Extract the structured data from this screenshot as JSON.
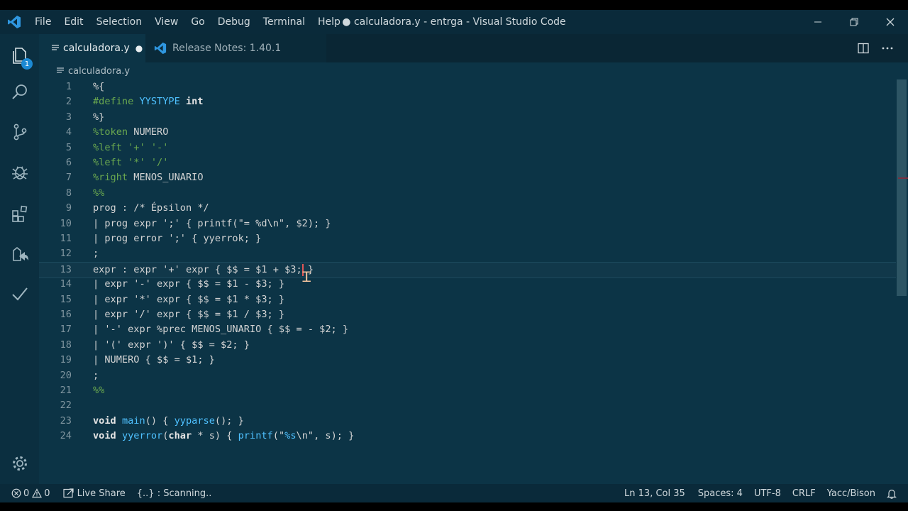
{
  "titlebar": {
    "menu": [
      "File",
      "Edit",
      "Selection",
      "View",
      "Go",
      "Debug",
      "Terminal",
      "Help"
    ],
    "window_title": "● calculadora.y - entrga - Visual Studio Code",
    "controls": {
      "minimize": "—",
      "restore": "❐",
      "close": "✕"
    }
  },
  "activity": {
    "items": [
      "explorer-icon",
      "search-icon",
      "source-control-icon",
      "debug-icon",
      "extensions-icon",
      "live-share-icon",
      "checkmark-icon"
    ],
    "explorer_badge": "1",
    "manage": "gear-icon"
  },
  "tabs": [
    {
      "label": "calculadora.y",
      "active": true,
      "dirty_indicator": "●"
    },
    {
      "label": "Release Notes: 1.40.1",
      "active": false
    }
  ],
  "breadcrumb": {
    "file": "calculadora.y"
  },
  "editor": {
    "current_line": 13,
    "lines": [
      {
        "n": "1",
        "segments": [
          {
            "t": "%{",
            "c": "p"
          }
        ]
      },
      {
        "n": "2",
        "segments": [
          {
            "t": "#define ",
            "c": "dir"
          },
          {
            "t": "YYSTYPE",
            "c": "mac"
          },
          {
            "t": " ",
            "c": "p"
          },
          {
            "t": "int",
            "c": "kw"
          }
        ]
      },
      {
        "n": "3",
        "segments": [
          {
            "t": "%}",
            "c": "p"
          }
        ]
      },
      {
        "n": "4",
        "segments": [
          {
            "t": "%token",
            "c": "dir"
          },
          {
            "t": " NUMERO",
            "c": "p"
          }
        ]
      },
      {
        "n": "5",
        "segments": [
          {
            "t": "%left '+' '-'",
            "c": "dir"
          }
        ]
      },
      {
        "n": "6",
        "segments": [
          {
            "t": "%left '*' '/'",
            "c": "dir"
          }
        ]
      },
      {
        "n": "7",
        "segments": [
          {
            "t": "%right",
            "c": "dir"
          },
          {
            "t": " MENOS_UNARIO",
            "c": "p"
          }
        ]
      },
      {
        "n": "8",
        "segments": [
          {
            "t": "%%",
            "c": "dir"
          }
        ]
      },
      {
        "n": "9",
        "segments": [
          {
            "t": "prog : /* Épsilon */",
            "c": "p"
          }
        ]
      },
      {
        "n": "10",
        "segments": [
          {
            "t": "| prog expr ';' { printf(\"= %d\\n\", $2); }",
            "c": "p"
          }
        ]
      },
      {
        "n": "11",
        "segments": [
          {
            "t": "| prog error ';' { yyerrok; }",
            "c": "p"
          }
        ]
      },
      {
        "n": "12",
        "segments": [
          {
            "t": ";",
            "c": "p"
          }
        ]
      },
      {
        "n": "13",
        "segments": [
          {
            "t": "expr : expr '+' expr { $$ = $1 + $3; }",
            "c": "p"
          }
        ]
      },
      {
        "n": "14",
        "segments": [
          {
            "t": "| expr '-' expr { $$ = $1 - $3; }",
            "c": "p"
          }
        ]
      },
      {
        "n": "15",
        "segments": [
          {
            "t": "| expr '*' expr { $$ = $1 * $3; }",
            "c": "p"
          }
        ]
      },
      {
        "n": "16",
        "segments": [
          {
            "t": "| expr '/' expr { $$ = $1 / $3; }",
            "c": "p"
          }
        ]
      },
      {
        "n": "17",
        "segments": [
          {
            "t": "| '-' expr %prec MENOS_UNARIO { $$ = - $2; }",
            "c": "p"
          }
        ]
      },
      {
        "n": "18",
        "segments": [
          {
            "t": "| '(' expr ')' { $$ = $2; }",
            "c": "p"
          }
        ]
      },
      {
        "n": "19",
        "segments": [
          {
            "t": "| NUMERO { $$ = $1; }",
            "c": "p"
          }
        ]
      },
      {
        "n": "20",
        "segments": [
          {
            "t": ";",
            "c": "p"
          }
        ]
      },
      {
        "n": "21",
        "segments": [
          {
            "t": "%%",
            "c": "dir"
          }
        ]
      },
      {
        "n": "22",
        "segments": []
      },
      {
        "n": "23",
        "segments": [
          {
            "t": "void",
            "c": "kw"
          },
          {
            "t": " ",
            "c": "p"
          },
          {
            "t": "main",
            "c": "fn"
          },
          {
            "t": "() { ",
            "c": "p"
          },
          {
            "t": "yyparse",
            "c": "fn"
          },
          {
            "t": "(); }",
            "c": "p"
          }
        ]
      },
      {
        "n": "24",
        "segments": [
          {
            "t": "void",
            "c": "kw"
          },
          {
            "t": " ",
            "c": "p"
          },
          {
            "t": "yyerror",
            "c": "fn"
          },
          {
            "t": "(",
            "c": "p"
          },
          {
            "t": "char",
            "c": "kw"
          },
          {
            "t": " * s) { ",
            "c": "p"
          },
          {
            "t": "printf",
            "c": "fn"
          },
          {
            "t": "(\"",
            "c": "p"
          },
          {
            "t": "%s",
            "c": "mac"
          },
          {
            "t": "\\n\", s); }",
            "c": "p"
          }
        ]
      }
    ]
  },
  "status": {
    "errors": "0",
    "warnings": "0",
    "live_share": "Live Share",
    "scanning": "{..} : Scanning..",
    "position": "Ln 13, Col 35",
    "spaces": "Spaces: 4",
    "encoding": "UTF-8",
    "eol": "CRLF",
    "language": "Yacc/Bison"
  },
  "colors": {
    "accent": "#1c8ad4",
    "editor_bg": "#0c3446",
    "directive": "#6aa84f",
    "macro": "#4fc1ff"
  }
}
